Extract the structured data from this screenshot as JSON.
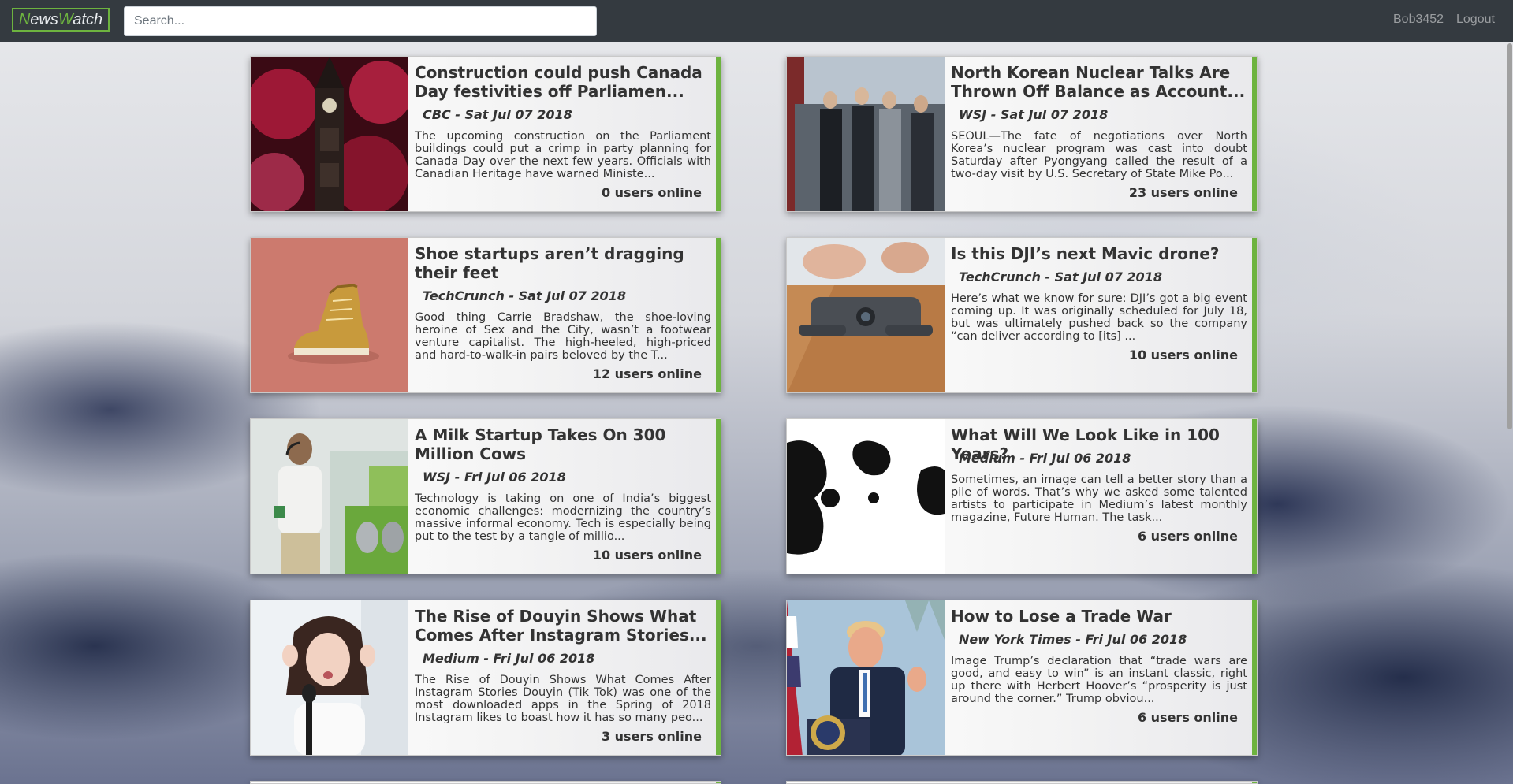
{
  "navbar": {
    "brand": {
      "n": "N",
      "ews": "ews",
      "w": "W",
      "atch": "atch"
    },
    "search_placeholder": "Search...",
    "user": "Bob3452",
    "logout": "Logout"
  },
  "articles": [
    {
      "title": "Construction could push Canada Day festivities off Parliamen...",
      "meta": "CBC - Sat Jul 07 2018",
      "description": "The upcoming construction on the Parliament buildings could put a crimp in party planning for Canada Day over the next few years. Officials with Canadian Heritage have warned Ministe...",
      "online": "0 users online",
      "image": "parliament-fireworks"
    },
    {
      "title": "North Korean Nuclear Talks Are Thrown Off Balance as Account...",
      "meta": "WSJ - Sat Jul 07 2018",
      "description": "SEOUL—The fate of negotiations over North Korea’s nuclear program was cast into doubt Saturday after Pyongyang called the result of a two-day visit by U.S. Secretary of State Mike Po...",
      "online": "23 users online",
      "image": "diplomats-handshake"
    },
    {
      "title": "Shoe startups aren’t dragging their feet",
      "meta": "TechCrunch - Sat Jul 07 2018",
      "description": "Good thing Carrie Bradshaw, the shoe-loving heroine of Sex and the City, wasn’t a footwear venture capitalist. The high-heeled, high-priced and hard-to-walk-in pairs beloved by the T...",
      "online": "12 users online",
      "image": "gold-sneaker"
    },
    {
      "title": "Is this DJI’s next Mavic drone?",
      "meta": "TechCrunch - Sat Jul 07 2018",
      "description": "Here’s what we know for sure: DJI’s got a big event coming up. It was originally scheduled for July 18, but was ultimately pushed back so the company “can deliver according to [its] ...",
      "online": "10 users online",
      "image": "drone"
    },
    {
      "title": "A Milk Startup Takes On 300 Million Cows",
      "meta": "WSJ - Fri Jul 06 2018",
      "description": "Technology is taking on one of India’s biggest economic challenges: modernizing the country’s massive informal economy. Tech is especially being put to the test by a tangle of millio...",
      "online": "10 users online",
      "image": "man-office"
    },
    {
      "title": "What Will We Look Like in 100 Years?",
      "meta": "Medium - Fri Jul 06 2018",
      "description": "Sometimes, an image can tell a better story than a pile of words. That’s why we asked some talented artists to participate in Medium’s latest monthly magazine, Future Human. The task...",
      "online": "6 users online",
      "image": "cow-pattern"
    },
    {
      "title": "The Rise of Douyin Shows What Comes After Instagram Stories...",
      "meta": "Medium - Fri Jul 06 2018",
      "description": "The Rise of Douyin Shows What Comes After Instagram Stories Douyin (Tik Tok) was one of the most downloaded apps in the Spring of 2018 Instagram likes to boast how it has so many peo...",
      "online": "3 users online",
      "image": "woman-microphone"
    },
    {
      "title": "How to Lose a Trade War",
      "meta": "New York Times - Fri Jul 06 2018",
      "description": "Image Trump’s declaration that “trade wars are good, and easy to win” is an instant classic, right up there with Herbert Hoover’s “prosperity is just around the corner.” Trump obviou...",
      "online": "6 users online",
      "image": "podium-speaker"
    }
  ]
}
